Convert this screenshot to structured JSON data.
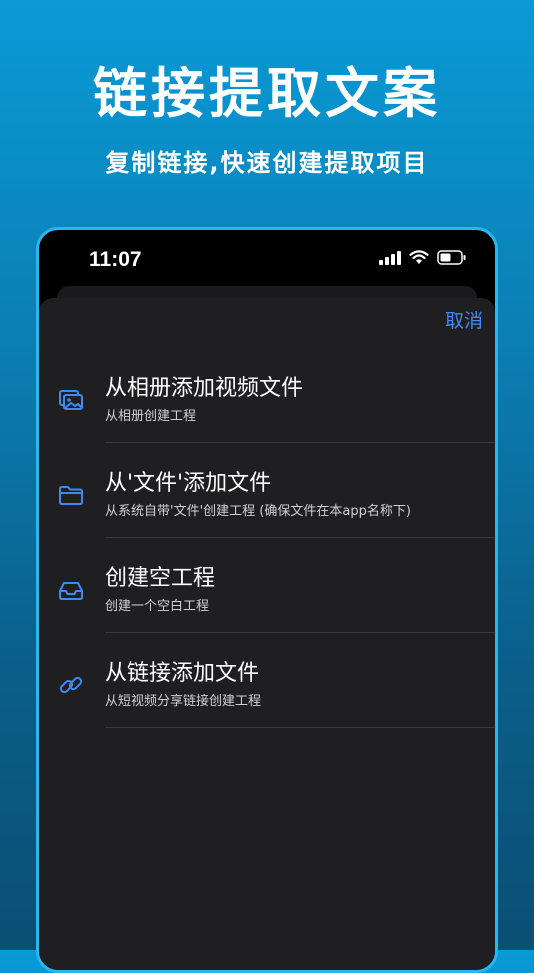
{
  "banner": {
    "title": "链接提取文案",
    "subtitle": "复制链接,快速创建提取项目"
  },
  "status_bar": {
    "time": "11:07"
  },
  "sheet": {
    "cancel_label": "取消",
    "options": [
      {
        "title": "从相册添加视频文件",
        "subtitle": "从相册创建工程",
        "icon": "photo-album-icon"
      },
      {
        "title": "从'文件'添加文件",
        "subtitle": "从系统自带'文件'创建工程 (确保文件在本app名称下)",
        "icon": "folder-icon"
      },
      {
        "title": "创建空工程",
        "subtitle": "创建一个空白工程",
        "icon": "tray-icon"
      },
      {
        "title": "从链接添加文件",
        "subtitle": "从短视频分享链接创建工程",
        "icon": "link-icon"
      }
    ]
  },
  "colors": {
    "accent": "#3d8bf2",
    "phone_border": "#29b7ee",
    "sheet_bg": "#1f1f21"
  }
}
